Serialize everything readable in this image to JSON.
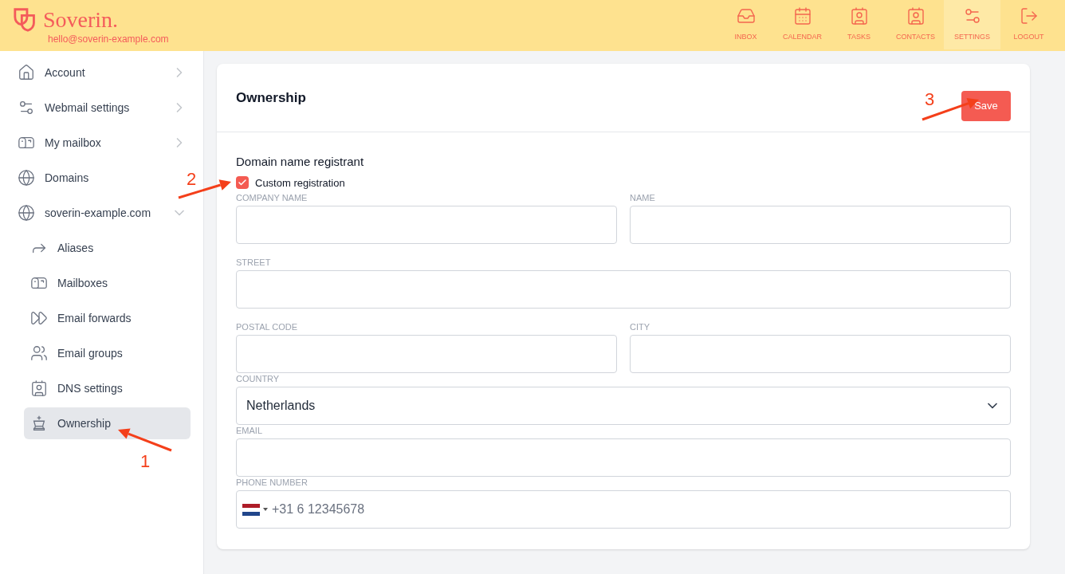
{
  "brand": {
    "name": "Soverin.",
    "email": "hello@soverin-example.com"
  },
  "nav": [
    {
      "label": "INBOX",
      "selected": false
    },
    {
      "label": "CALENDAR",
      "selected": false
    },
    {
      "label": "TASKS",
      "selected": false
    },
    {
      "label": "CONTACTS",
      "selected": false
    },
    {
      "label": "SETTINGS",
      "selected": true
    },
    {
      "label": "LOGOUT",
      "selected": false
    }
  ],
  "sidebar": {
    "items": [
      {
        "label": "Account",
        "expanded": false,
        "selected": false
      },
      {
        "label": "Webmail settings",
        "expanded": false,
        "selected": false
      },
      {
        "label": "My mailbox",
        "expanded": false,
        "selected": false
      },
      {
        "label": "Domains",
        "selected": false
      },
      {
        "label": "soverin-example.com",
        "expanded": true,
        "selected": false,
        "children": [
          {
            "label": "Aliases",
            "selected": false
          },
          {
            "label": "Mailboxes",
            "selected": false
          },
          {
            "label": "Email forwards",
            "selected": false
          },
          {
            "label": "Email groups",
            "selected": false
          },
          {
            "label": "DNS settings",
            "selected": false
          },
          {
            "label": "Ownership",
            "selected": true
          }
        ]
      }
    ]
  },
  "card": {
    "title": "Ownership",
    "save_button": "Save",
    "section_title": "Domain name registrant",
    "checkbox": {
      "label": "Custom registration",
      "checked": true
    },
    "rows": [
      [
        {
          "label": "COMPANY NAME",
          "kind": "text"
        },
        {
          "label": "NAME",
          "kind": "text"
        }
      ],
      [
        {
          "label": "STREET",
          "kind": "text"
        }
      ],
      [
        {
          "label": "POSTAL CODE",
          "kind": "text"
        },
        {
          "label": "CITY",
          "kind": "text"
        }
      ],
      [
        {
          "label": "COUNTRY",
          "kind": "select",
          "value": "Netherlands"
        }
      ],
      [
        {
          "label": "EMAIL",
          "kind": "text"
        }
      ],
      [
        {
          "label": "PHONE NUMBER",
          "kind": "phone",
          "placeholder": "+31 6 12345678"
        }
      ]
    ]
  },
  "annotations": [
    {
      "number": "1"
    },
    {
      "number": "2"
    },
    {
      "number": "3"
    }
  ]
}
